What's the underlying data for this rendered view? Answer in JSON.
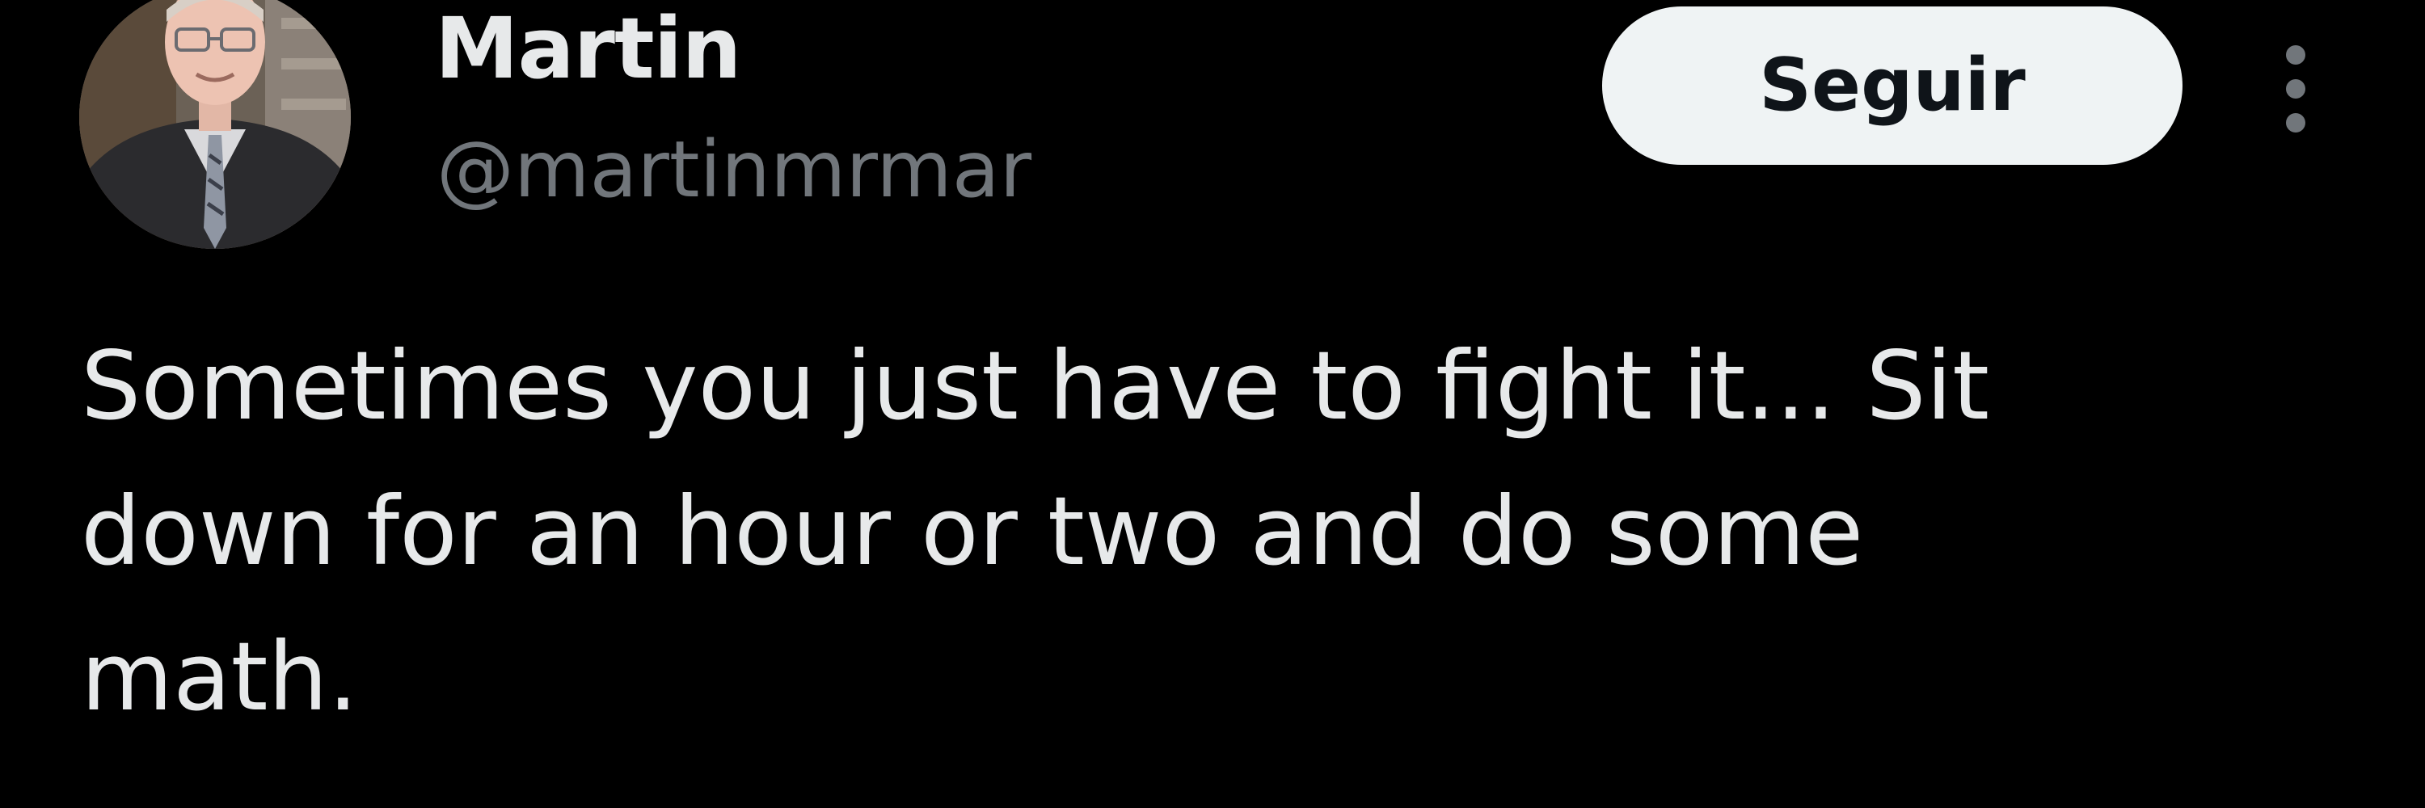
{
  "tweet": {
    "author": {
      "name": "Martin",
      "handle": "@martinmrmar"
    },
    "follow_label": "Seguir",
    "more_icon": "more-vertical-icon",
    "text_lines": [
      "Sometimes you just have to fight it... Sit",
      "down for an hour or two and do some",
      "math."
    ]
  },
  "colors": {
    "background": "#000000",
    "primary_text": "#e7e9ea",
    "secondary_text": "#71767b",
    "button_bg": "#eff3f4",
    "button_text": "#0f1419"
  }
}
